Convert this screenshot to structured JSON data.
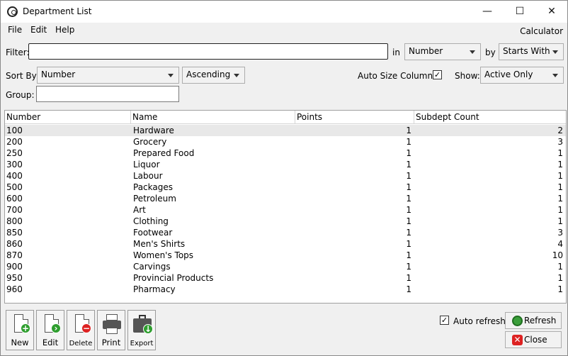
{
  "window": {
    "title": "Department List",
    "minimize_glyph": "—",
    "maximize_glyph": "☐",
    "close_glyph": "✕"
  },
  "menu": {
    "file": "File",
    "edit": "Edit",
    "help": "Help",
    "calculator": "Calculator"
  },
  "filter": {
    "label": "Filter:",
    "value": "",
    "in_label": "in",
    "in_value": "Number",
    "by_label": "by",
    "by_value": "Starts With"
  },
  "sort": {
    "label": "Sort By:",
    "field": "Number",
    "direction": "Ascending",
    "auto_size_label": "Auto Size Columns",
    "auto_size_checked": "✓",
    "show_label": "Show:",
    "show_value": "Active Only"
  },
  "group": {
    "label": "Group:",
    "value": ""
  },
  "grid": {
    "columns": [
      "Number",
      "Name",
      "Points",
      "Subdept Count"
    ],
    "rows": [
      [
        "100",
        "Hardware",
        "1",
        "2"
      ],
      [
        "200",
        "Grocery",
        "1",
        "3"
      ],
      [
        "250",
        "Prepared Food",
        "1",
        "1"
      ],
      [
        "300",
        "Liquor",
        "1",
        "1"
      ],
      [
        "400",
        "Labour",
        "1",
        "1"
      ],
      [
        "500",
        "Packages",
        "1",
        "1"
      ],
      [
        "600",
        "Petroleum",
        "1",
        "1"
      ],
      [
        "700",
        "Art",
        "1",
        "1"
      ],
      [
        "800",
        "Clothing",
        "1",
        "1"
      ],
      [
        "850",
        "Footwear",
        "1",
        "3"
      ],
      [
        "860",
        "Men's Shirts",
        "1",
        "4"
      ],
      [
        "870",
        "Women's Tops",
        "1",
        "10"
      ],
      [
        "900",
        "Carvings",
        "1",
        "1"
      ],
      [
        "950",
        "Provincial Products",
        "1",
        "1"
      ],
      [
        "960",
        "Pharmacy",
        "1",
        "1"
      ]
    ]
  },
  "toolbar": {
    "new": "New",
    "edit": "Edit",
    "delete": "Delete",
    "print": "Print",
    "export": "Export"
  },
  "footer": {
    "auto_refresh_label": "Auto refresh",
    "auto_refresh_checked": "✓",
    "refresh": "Refresh",
    "close": "Close"
  }
}
